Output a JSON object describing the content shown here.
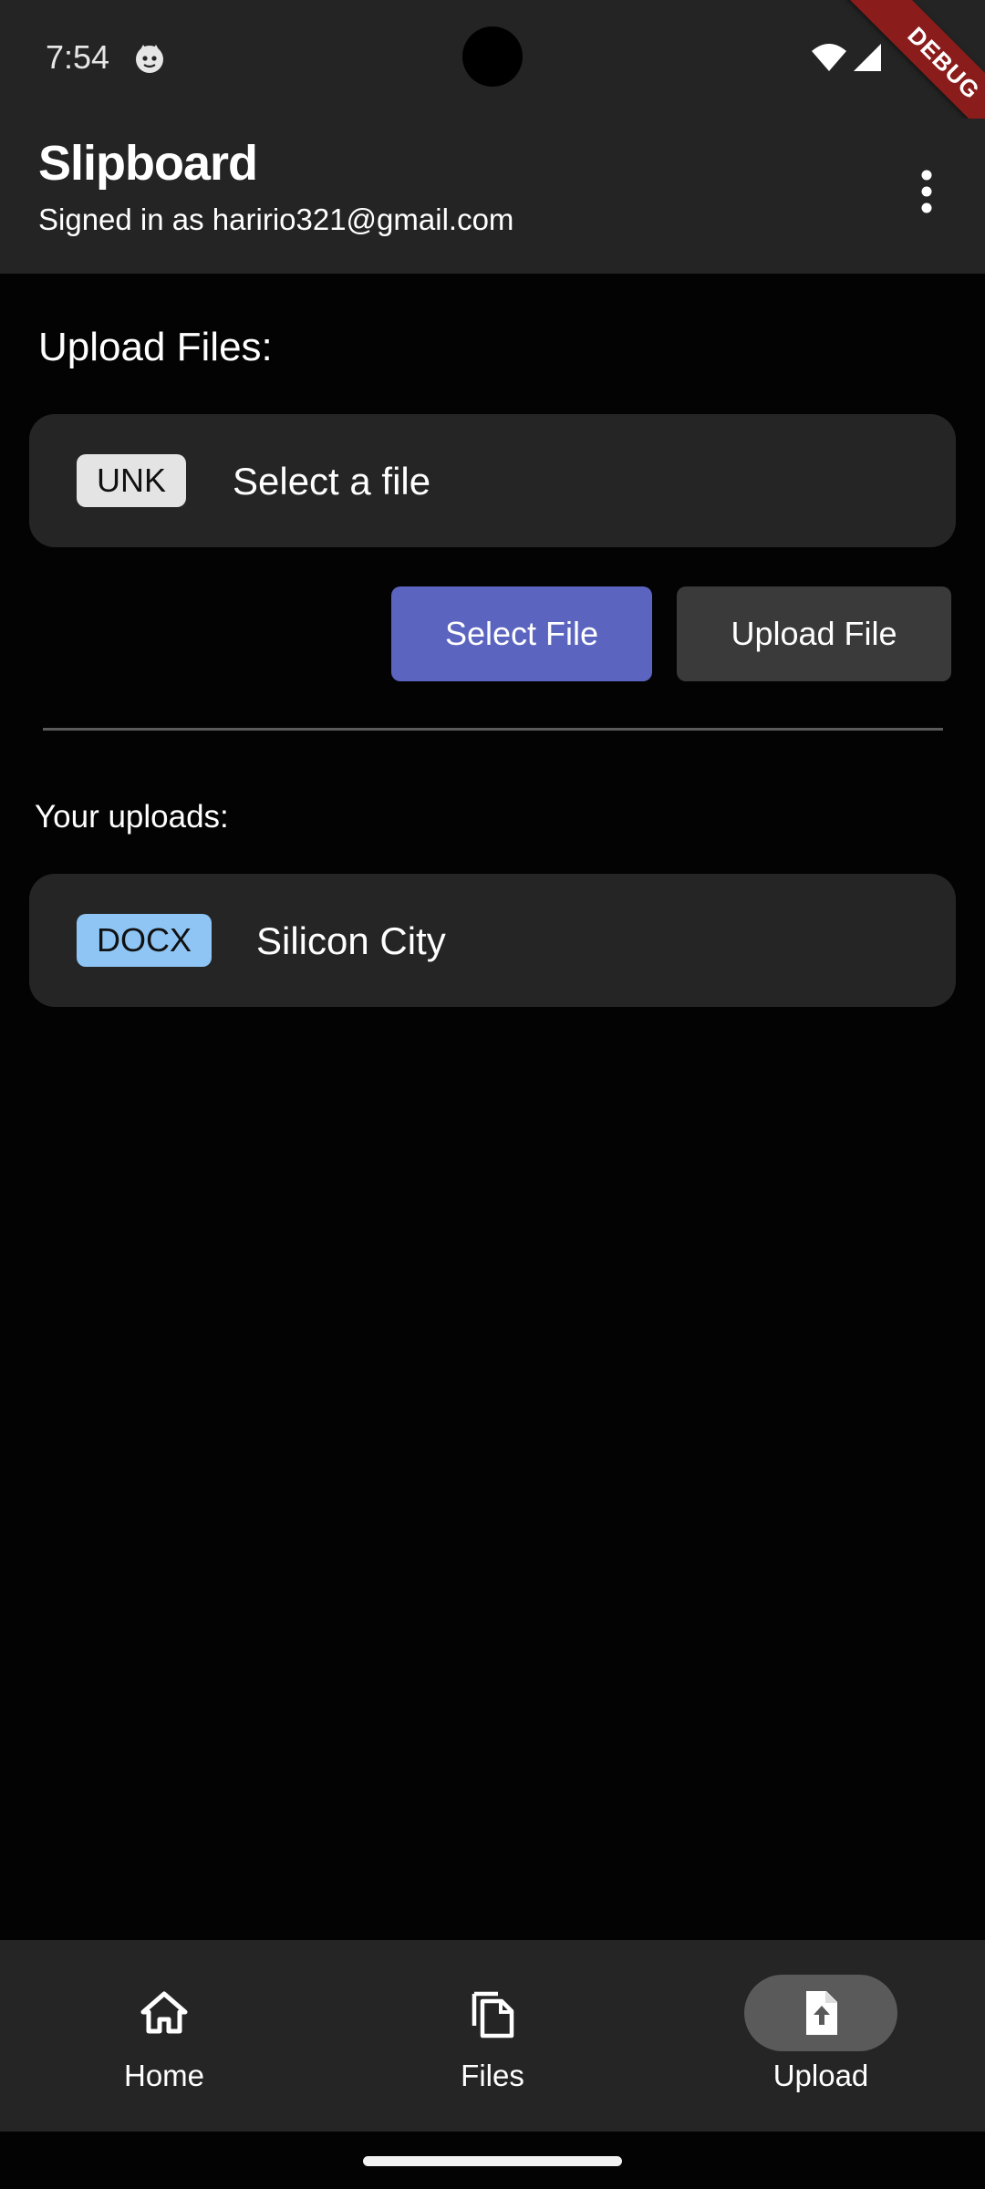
{
  "status_bar": {
    "time": "7:54",
    "debug_banner": "DEBUG",
    "icons": [
      "app-notification-icon",
      "wifi-icon",
      "cell-signal-icon"
    ]
  },
  "app_bar": {
    "title": "Slipboard",
    "subtitle": "Signed in as haririo321@gmail.com",
    "menu_icon": "more-vert-icon"
  },
  "upload_section": {
    "heading": "Upload Files:",
    "selected_file": {
      "badge": "UNK",
      "badge_color": "#e4e4e4",
      "name": "Select a file"
    },
    "select_button": "Select File",
    "upload_button": "Upload File"
  },
  "uploads": {
    "label": "Your uploads:",
    "items": [
      {
        "badge": "DOCX",
        "badge_color": "#8ec5f4",
        "name": "Silicon City"
      }
    ]
  },
  "bottom_nav": {
    "items": [
      {
        "label": "Home",
        "icon": "home-icon",
        "active": false
      },
      {
        "label": "Files",
        "icon": "files-icon",
        "active": false
      },
      {
        "label": "Upload",
        "icon": "upload-file-icon",
        "active": true
      }
    ]
  },
  "colors": {
    "app_bar": "#242424",
    "background": "#030303",
    "card": "#252525",
    "primary_button": "#5b64bf",
    "secondary_button": "#3a3a3a",
    "debug_ribbon": "#8b1c1c"
  }
}
